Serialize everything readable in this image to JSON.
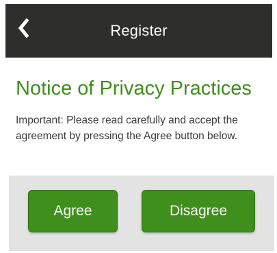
{
  "header": {
    "title": "Register",
    "back_icon": "chevron-left-icon"
  },
  "notice": {
    "title": "Notice of Privacy Practices",
    "body": "Important: Please read carefully and accept the agreement by pressing the Agree button below."
  },
  "actions": {
    "agree_label": "Agree",
    "disagree_label": "Disagree"
  },
  "colors": {
    "header_background": "#2e2e2c",
    "accent_green": "#3f8f1c",
    "button_area_background": "#e3e3e3"
  }
}
